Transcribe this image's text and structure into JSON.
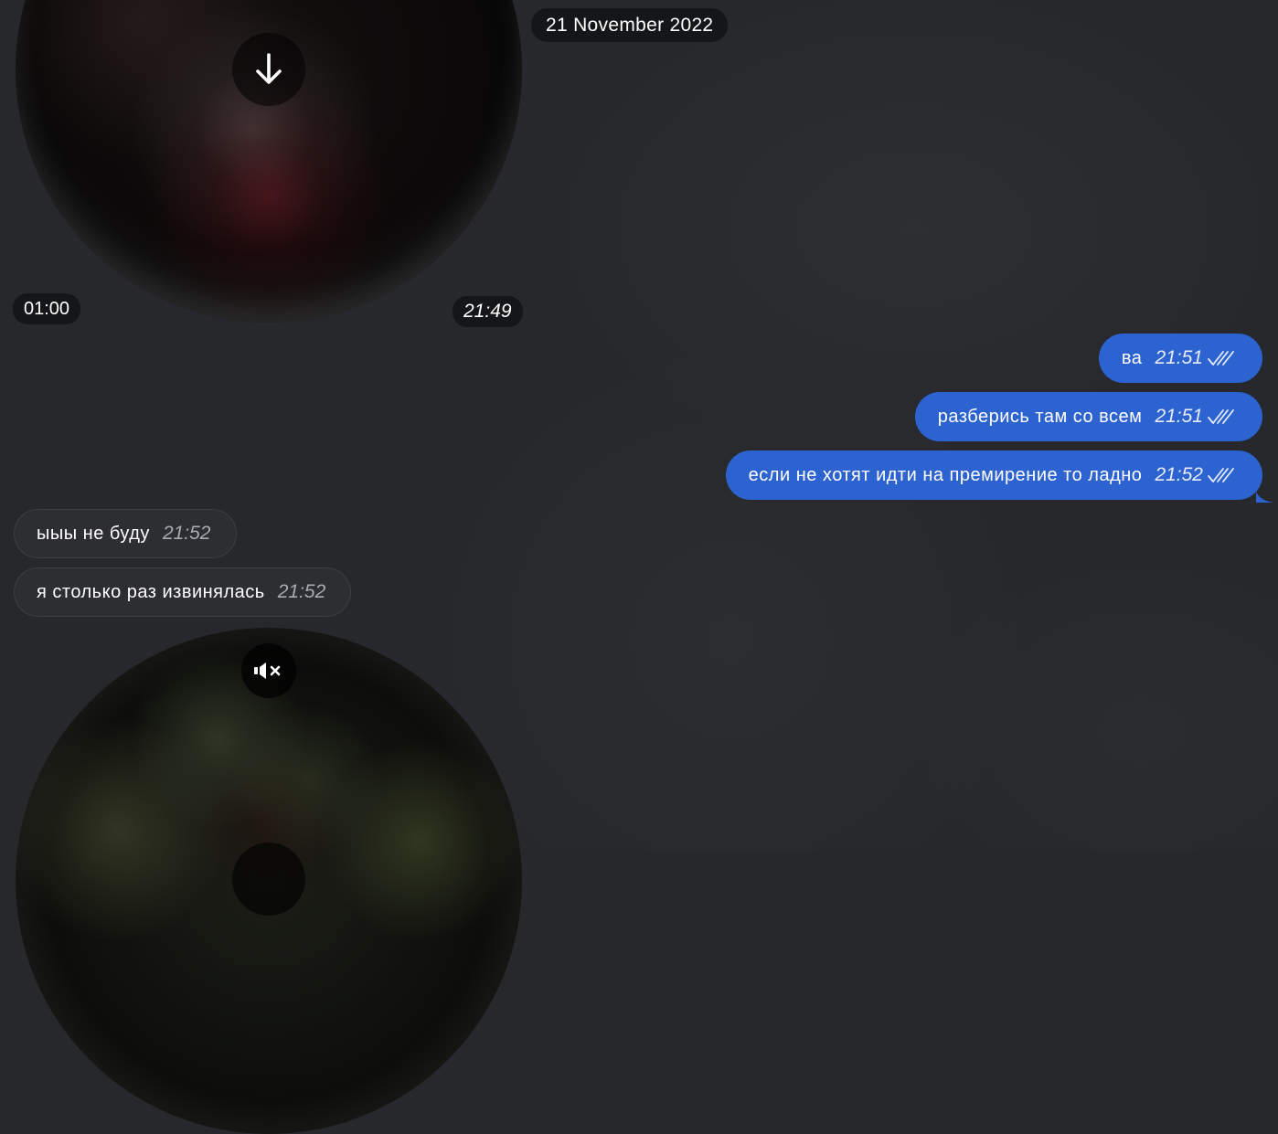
{
  "chat": {
    "date_separator": "21 November 2022",
    "video_message_1": {
      "duration": "01:00",
      "time": "21:49",
      "action_icon": "download-arrow-icon"
    },
    "outgoing_messages": [
      {
        "text": "ва",
        "time": "21:51",
        "status_icon": "double-check-icon"
      },
      {
        "text": "разберись там со всем",
        "time": "21:51",
        "status_icon": "double-check-icon"
      },
      {
        "text": "если не хотят идти на премирение то ладно",
        "time": "21:52",
        "status_icon": "double-check-icon"
      }
    ],
    "incoming_messages": [
      {
        "text": "ыыы не буду",
        "time": "21:52"
      },
      {
        "text": "я столько раз извинялась",
        "time": "21:52"
      }
    ],
    "video_message_2": {
      "status_icon": "muted-speaker-icon"
    }
  },
  "colors": {
    "background": "#26282c",
    "outgoing_bubble": "#2d63d0",
    "incoming_bubble": "#2c2e32"
  }
}
